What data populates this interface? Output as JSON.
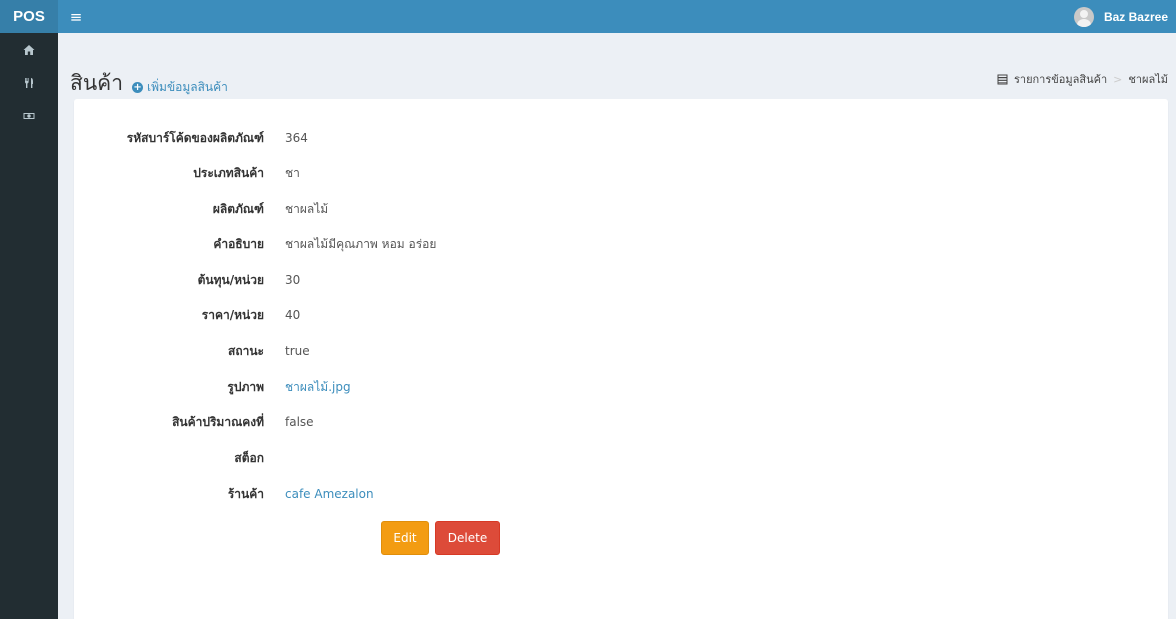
{
  "navbar": {
    "brand": "POS",
    "menu_icon": "≡",
    "user_name": "Baz Bazree"
  },
  "sidebar": {
    "items": [
      {
        "icon": "home-icon"
      },
      {
        "icon": "cutlery-icon"
      },
      {
        "icon": "money-icon"
      }
    ]
  },
  "header": {
    "title": "สินค้า",
    "add_label": "เพิ่มข้อมูลสินค้า"
  },
  "breadcrumb": {
    "items": [
      "รายการข้อมูลสินค้า",
      "ชาผลไม้"
    ],
    "separator": ">"
  },
  "details": {
    "fields": [
      {
        "label": "รหัสบาร์โค้ดของผลิตภัณฑ์",
        "value": "364"
      },
      {
        "label": "ประเภทสินค้า",
        "value": "ชา"
      },
      {
        "label": "ผลิตภัณฑ์",
        "value": "ชาผลไม้"
      },
      {
        "label": "คำอธิบาย",
        "value": "ชาผลไม้มีคุณภาพ หอม อร่อย"
      },
      {
        "label": "ต้นทุน/หน่วย",
        "value": "30"
      },
      {
        "label": "ราคา/หน่วย",
        "value": "40"
      },
      {
        "label": "สถานะ",
        "value": "true"
      },
      {
        "label": "รูปภาพ",
        "value": "ชาผลไม้.jpg"
      },
      {
        "label": "สินค้าปริมาณคงที่",
        "value": "false"
      },
      {
        "label": "สต็อก",
        "value": ""
      },
      {
        "label": "ร้านค้า",
        "value": "cafe Amezalon"
      }
    ]
  },
  "actions": {
    "edit_label": "Edit",
    "delete_label": "Delete"
  },
  "colors": {
    "navbar": "#3c8dbc",
    "brand_bg": "#367fa9",
    "sidebar": "#222d32",
    "edit": "#f39c12",
    "delete": "#dd4b39",
    "link": "#3c8dbc"
  }
}
